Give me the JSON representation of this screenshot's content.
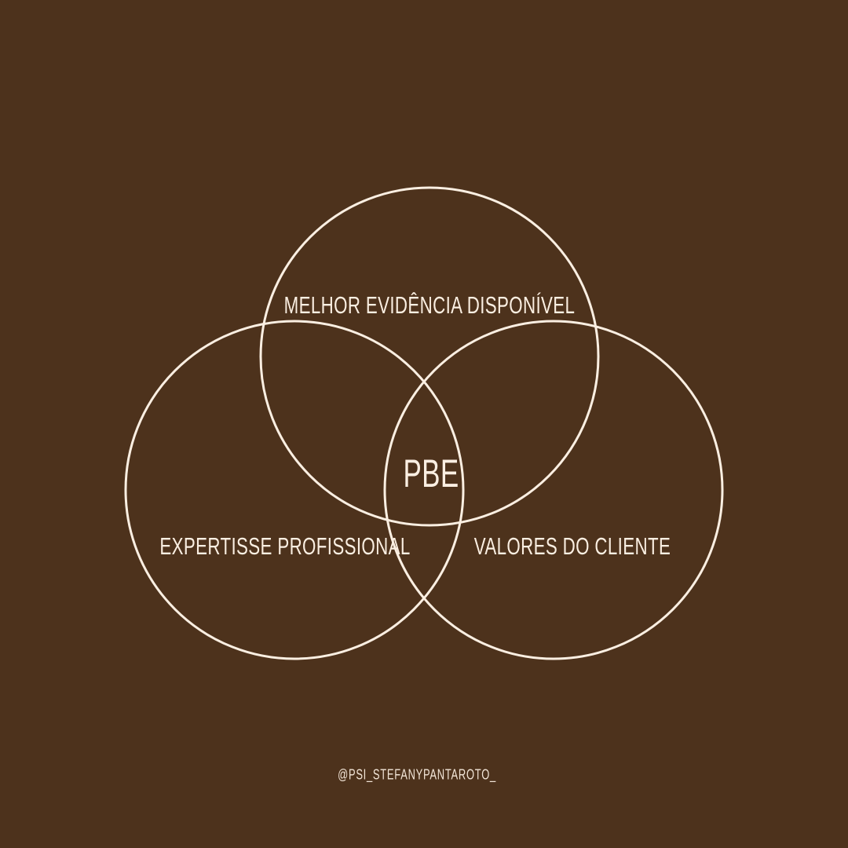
{
  "diagram": {
    "top_circle_label": "MELHOR EVIDÊNCIA DISPONÍVEL",
    "left_circle_label": "EXPERTISSE PROFISSIONAL",
    "right_circle_label": "VALORES DO CLIENTE",
    "center_label": "PBE"
  },
  "footer": {
    "credit": "@PSI_STEFANYPANTAROTO_"
  },
  "colors": {
    "background": "#4d321c",
    "foreground": "#fbefe2"
  }
}
